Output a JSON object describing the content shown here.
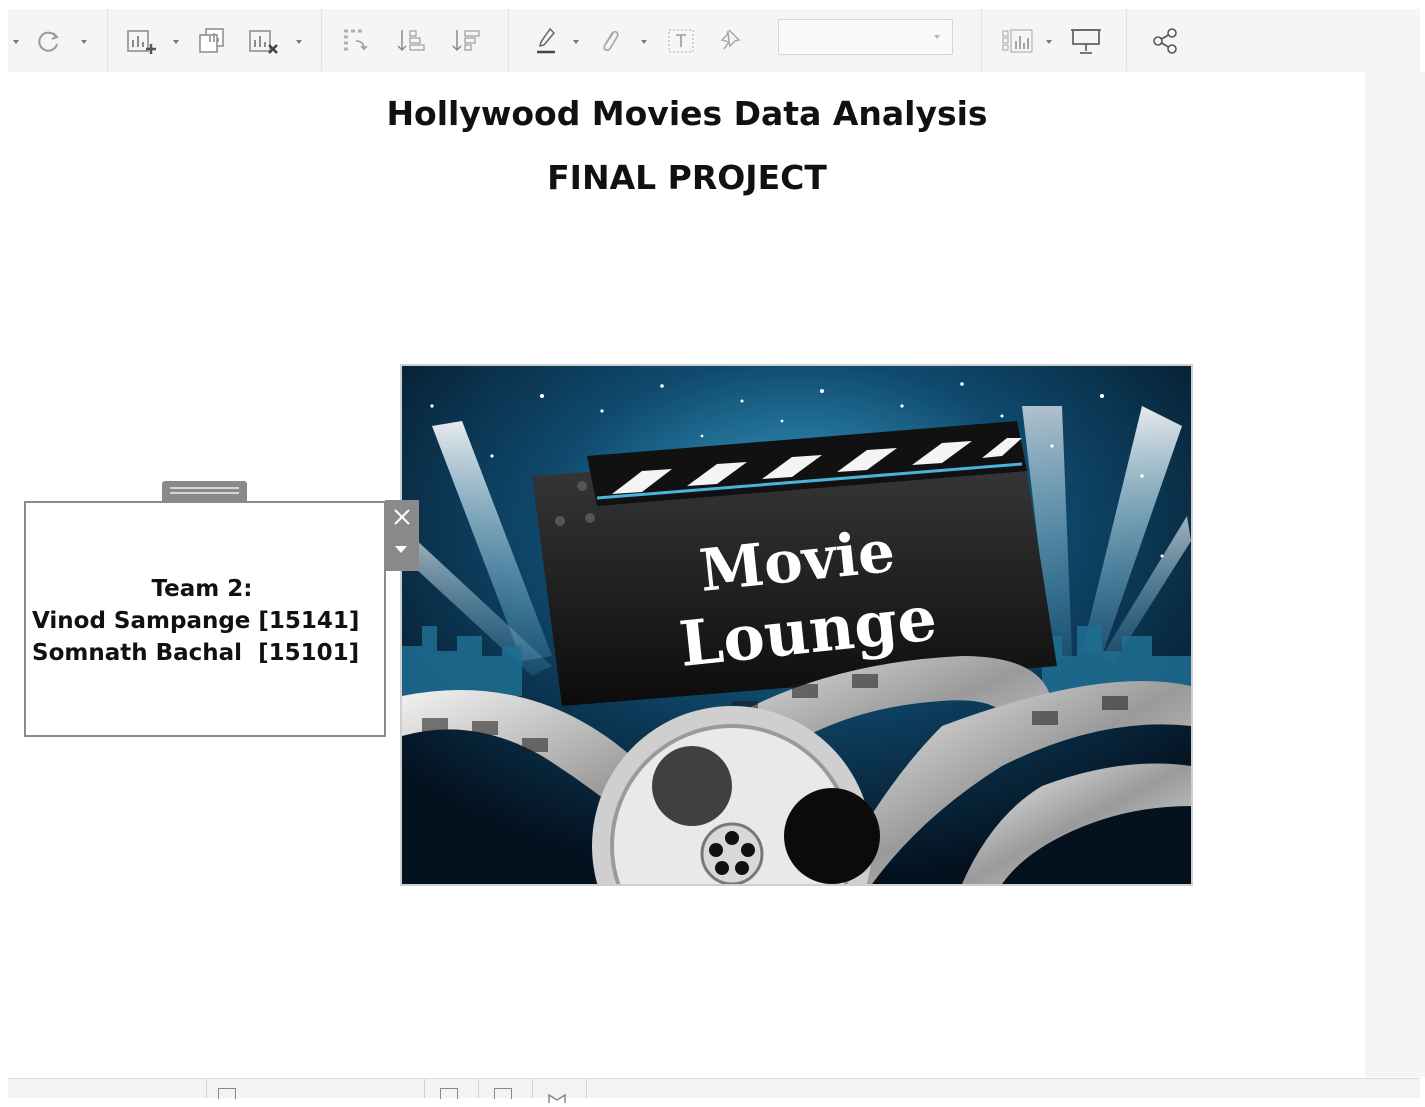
{
  "toolbar": {
    "icons": [
      "refresh-icon",
      "new-worksheet-icon",
      "duplicate-sheet-icon",
      "clear-sheet-icon",
      "swap-rows-columns-icon",
      "sort-ascending-icon",
      "sort-descending-icon",
      "highlight-icon",
      "group-members-icon",
      "show-labels-icon",
      "fix-axes-icon",
      "show-me-icon",
      "presentation-mode-icon",
      "share-icon"
    ],
    "fit_value": ""
  },
  "dashboard": {
    "title": "Hollywood Movies Data Analysis",
    "subtitle": "FINAL PROJECT"
  },
  "poster": {
    "line1": "Movie",
    "line2": "Lounge"
  },
  "textbox": {
    "line1": "Team 2:",
    "line2": "Vinod Sampange [15141]",
    "line3": "Somnath Bachal  [15101]"
  },
  "colors": {
    "toolbar_bg": "#f5f5f5",
    "poster_bg": "#082033",
    "spotlight": "#1f7fa8"
  }
}
